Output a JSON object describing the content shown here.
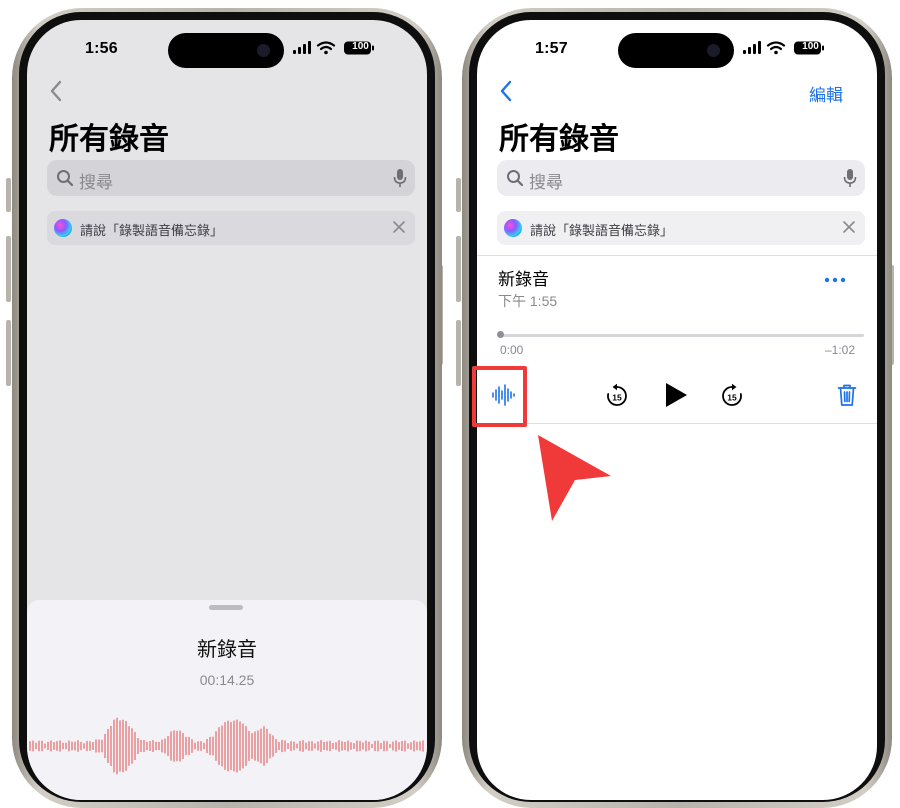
{
  "left_phone": {
    "status": {
      "time": "1:56",
      "battery": "100"
    },
    "title": "所有錄音",
    "search": {
      "placeholder": "搜尋"
    },
    "siri_suggestion": "請說「錄製語音備忘錄」",
    "sheet": {
      "title": "新錄音",
      "timer": "00:14.25"
    }
  },
  "right_phone": {
    "status": {
      "time": "1:57",
      "battery": "100"
    },
    "nav": {
      "edit_label": "編輯"
    },
    "title": "所有錄音",
    "search": {
      "placeholder": "搜尋"
    },
    "siri_suggestion": "請說「錄製語音備忘錄」",
    "recording": {
      "name": "新錄音",
      "time": "下午 1:55",
      "elapsed": "0:00",
      "remaining": "–1:02",
      "progress": 0
    },
    "controls": [
      "waveform-icon",
      "skip-back-15-icon",
      "play-icon",
      "skip-forward-15-icon",
      "trash-icon"
    ]
  },
  "annotation": {
    "highlight_color": "#f03a3a",
    "arrow_color": "#f03a3a",
    "target": "waveform-icon"
  },
  "colors": {
    "accent": "#1e72e8",
    "waveform": "#e06b6b",
    "left_screen_bg": "#e5e5e8",
    "right_screen_bg": "#ffffff"
  }
}
